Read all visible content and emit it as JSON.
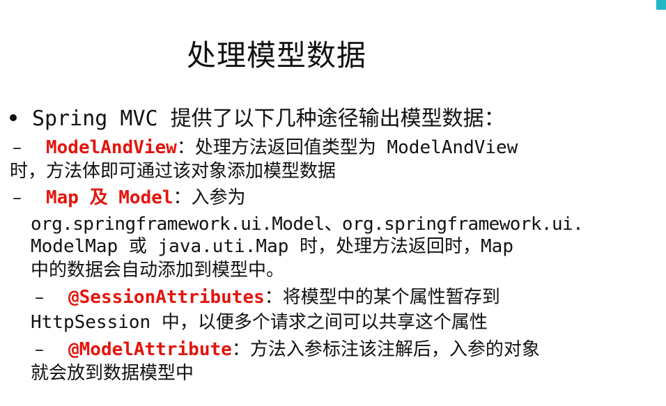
{
  "slide": {
    "title": "处理模型数据",
    "intro": "Spring MVC 提供了以下几种途径输出模型数据：",
    "item1": {
      "dash": "–",
      "key": "ModelAndView",
      "text1": "：处理方法返回值类型为 ModelAndView",
      "text2": "时，方法体即可通过该对象添加模型数据"
    },
    "item2": {
      "dash": "–",
      "key": "Map 及 Model",
      "text1": "：入参为",
      "text2": "org.springframework.ui.Model、org.springframework.ui.",
      "text3": "ModelMap 或 java.uti.Map 时，处理方法返回时，Map",
      "text4": "中的数据会自动添加到模型中。"
    },
    "item3": {
      "dash": "–",
      "key": "@SessionAttributes",
      "text1": "：将模型中的某个属性暂存到",
      "text2": "HttpSession 中，以便多个请求之间可以共享这个属性"
    },
    "item4": {
      "dash": "–",
      "key": "@ModelAttribute",
      "text1": "：方法入参标注该注解后，入参的对象",
      "text2": "就会放到数据模型中"
    }
  },
  "colors": {
    "accent": "#e4140d",
    "corner": "#22b8c7",
    "text": "#111111"
  }
}
